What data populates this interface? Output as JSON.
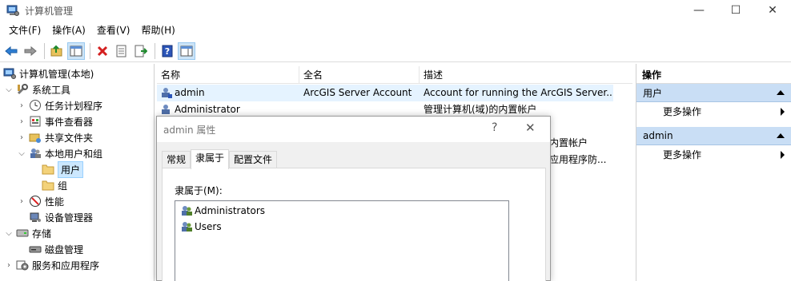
{
  "window": {
    "title": "计算机管理",
    "minimize": "—",
    "maximize": "☐",
    "close": "✕"
  },
  "menu": [
    "文件(F)",
    "操作(A)",
    "查看(V)",
    "帮助(H)"
  ],
  "toolbar_icons": [
    "back-icon",
    "forward-icon",
    "up-folder-icon",
    "show-tree-icon",
    "delete-icon",
    "properties-icon",
    "export-icon",
    "help-icon",
    "action-pane-icon"
  ],
  "tree": {
    "root": "计算机管理(本地)",
    "system_tools": "系统工具",
    "task_scheduler": "任务计划程序",
    "event_viewer": "事件查看器",
    "shared_folders": "共享文件夹",
    "local_users": "本地用户和组",
    "users": "用户",
    "groups": "组",
    "performance": "性能",
    "device_manager": "设备管理器",
    "storage": "存储",
    "disk_management": "磁盘管理",
    "services_apps": "服务和应用程序"
  },
  "list": {
    "columns": [
      "名称",
      "全名",
      "描述"
    ],
    "rows": [
      {
        "name": "admin",
        "fullname": "ArcGIS Server Account",
        "desc": "Account for running the ArcGIS Server..."
      },
      {
        "name": "Administrator",
        "fullname": "",
        "desc": "管理计算机(域)的内置帐户"
      },
      {
        "name": "",
        "fullname": "",
        "desc": "内置帐户"
      },
      {
        "name": "",
        "fullname": "",
        "desc": "应用程序防..."
      }
    ]
  },
  "actions": {
    "title": "操作",
    "sections": [
      {
        "label": "用户",
        "item": "更多操作"
      },
      {
        "label": "admin",
        "item": "更多操作"
      }
    ]
  },
  "dialog": {
    "title": "admin 属性",
    "help": "?",
    "close": "✕",
    "tabs": [
      "常规",
      "隶属于",
      "配置文件"
    ],
    "member_label": "隶属于(M):",
    "members": [
      "Administrators",
      "Users"
    ]
  }
}
